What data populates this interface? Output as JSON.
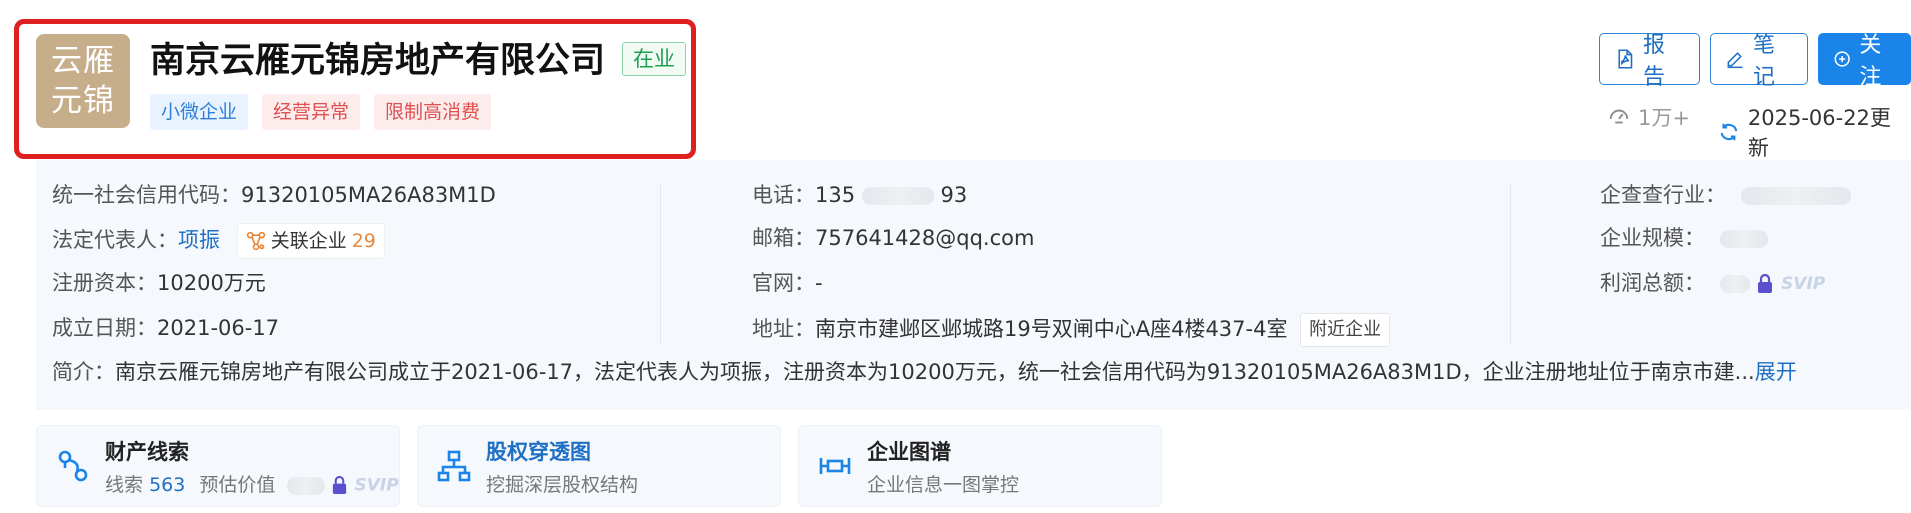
{
  "header": {
    "logo_line1": "云雁",
    "logo_line2": "元锦",
    "company_name": "南京云雁元锦房地产有限公司",
    "status": "在业",
    "tags": [
      "小微企业",
      "经营异常",
      "限制高消费"
    ]
  },
  "actions": {
    "report_label": "报告",
    "note_label": "笔记",
    "follow_label": "关注",
    "views": "1万+",
    "updated": "2025-06-22更新"
  },
  "info": {
    "credit_code_label": "统一社会信用代码：",
    "credit_code": "91320105MA26A83M1D",
    "legal_rep_label": "法定代表人：",
    "legal_rep": "项振",
    "related_label": "关联企业",
    "related_count": "29",
    "capital_label": "注册资本：",
    "capital": "10200万元",
    "founded_label": "成立日期：",
    "founded": "2021-06-17",
    "phone_label": "电话：",
    "phone_prefix": "135",
    "phone_suffix": "93",
    "email_label": "邮箱：",
    "email": "757641428@qq.com",
    "website_label": "官网：",
    "website": "-",
    "address_label": "地址：",
    "address": "南京市建邺区邺城路19号双闸中心A座4楼437-4室",
    "nearby_label": "附近企业",
    "industry_label": "企查查行业：",
    "scale_label": "企业规模：",
    "profit_label": "利润总额：",
    "svip": "SVIP",
    "intro_label": "简介：",
    "intro": "南京云雁元锦房地产有限公司成立于2021-06-17，法定代表人为项振，注册资本为10200万元，统一社会信用代码为91320105MA26A83M1D，企业注册地址位于南京市建...",
    "expand_label": "展开"
  },
  "cards": [
    {
      "title": "财产线索",
      "sub_prefix": "线索",
      "sub_count": "563",
      "sub_suffix": "预估价值"
    },
    {
      "title": "股权穿透图",
      "sub": "挖掘深层股权结构"
    },
    {
      "title": "企业图谱",
      "sub": "企业信息一图掌控"
    }
  ],
  "colors": {
    "primary": "#1a84e8",
    "highlight": "#e02020",
    "status_green": "#1e9f52",
    "logo_bg": "#c6ae8b"
  }
}
